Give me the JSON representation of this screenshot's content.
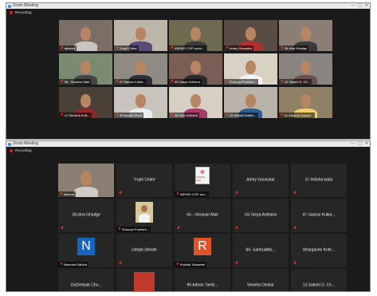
{
  "top_window": {
    "title": "Zoom Meeting",
    "controls": [
      "—",
      "□",
      "✕"
    ],
    "recording_label": "Recording",
    "tiles": [
      {
        "name": "atharva",
        "wall": "#7a6e66",
        "shirt": "#c9c4bf"
      },
      {
        "name": "Trupti Chitre",
        "wall": "#bdb5aa",
        "shirt": "#5a4a7a"
      },
      {
        "name": "ABSMS COP accro...",
        "wall": "#6d6a50",
        "shirt": "#3c3c3c",
        "active": true
      },
      {
        "name": "Amey Gavaskar",
        "wall": "#5a4c44",
        "shirt": "#b03030"
      },
      {
        "name": "28 Isha Ghadge",
        "wall": "#8b7e75",
        "shirt": "#3a3a3a"
      },
      {
        "name": "55 - Shravan Mali",
        "wall": "#7d8a72",
        "shirt": "#444444"
      },
      {
        "name": "47 Saurav Kulka...",
        "wall": "#8f8a82",
        "shirt": "#2f2f3a"
      },
      {
        "name": "03-Tanya Asthana",
        "wall": "#7a5e55",
        "shirt": "#2a2a2a"
      },
      {
        "name": "Shaurya Pudhare...",
        "wall": "#d8d1c4",
        "shirt": "#f4f4f4"
      },
      {
        "name": "13 Sakshi D. Ch...",
        "wall": "#8a8480",
        "shirt": "#6b4f4f"
      },
      {
        "name": "12 Shivank Kulk...",
        "wall": "#4a4038",
        "shirt": "#8a2a2a"
      },
      {
        "name": "39 Awadh Dhuri",
        "wall": "#c8c4bd",
        "shirt": "#ececec"
      },
      {
        "name": "46 Ekta Kulkarni",
        "wall": "#d6cfc4",
        "shirt": "#a83c6a"
      },
      {
        "name": "29 Shefali Dabhir...",
        "wall": "#b9b3aa",
        "shirt": "#2f5f8a"
      },
      {
        "name": "61 Atharva Suryav...",
        "wall": "#8f8066",
        "shirt": "#f0d070"
      }
    ]
  },
  "bottom_window": {
    "title": "Zoom Meeting",
    "controls": [
      "—",
      "□",
      "✕"
    ],
    "recording_label": "Recording",
    "tiles": [
      {
        "kind": "video",
        "caption": "atharva",
        "wall": "#8b7e72",
        "shirt": "#cfcac4",
        "active": true
      },
      {
        "kind": "name",
        "label": "Trupti Chitre"
      },
      {
        "kind": "logo",
        "caption": "ABSMS COP acc...",
        "logo_text": "AISSMS COP"
      },
      {
        "kind": "name",
        "label": "Amey Gavaskar"
      },
      {
        "kind": "name",
        "label": "37-Hitisha kadu"
      },
      {
        "kind": "name",
        "label": "28-Isha Ghadge"
      },
      {
        "kind": "photo",
        "caption": "Shaurya Pudhare..."
      },
      {
        "kind": "name",
        "label": "55 - Shravan Mali"
      },
      {
        "kind": "name",
        "label": "03-Tanya Asthana"
      },
      {
        "kind": "name",
        "label": "47 Saurav Kulka..."
      },
      {
        "kind": "avatar",
        "letter": "N",
        "color": "#1565c0",
        "caption": "Namrata Rathod"
      },
      {
        "kind": "name",
        "label": "Deepti Shinde"
      },
      {
        "kind": "avatar",
        "letter": "R",
        "color": "#e0532a",
        "caption": "Rushita Takawale"
      },
      {
        "kind": "name",
        "label": "84- Samruddhi..."
      },
      {
        "kind": "name",
        "label": "Bhargavee Kolh..."
      },
      {
        "kind": "name",
        "label": "15(Deepak Cho..."
      },
      {
        "kind": "redblock",
        "color": "#c0392b"
      },
      {
        "kind": "name",
        "label": "95 Adnan Tamb..."
      },
      {
        "kind": "name",
        "label": "Shweta Deskar"
      },
      {
        "kind": "name",
        "label": "13 Sakshi D. Ch..."
      }
    ]
  }
}
